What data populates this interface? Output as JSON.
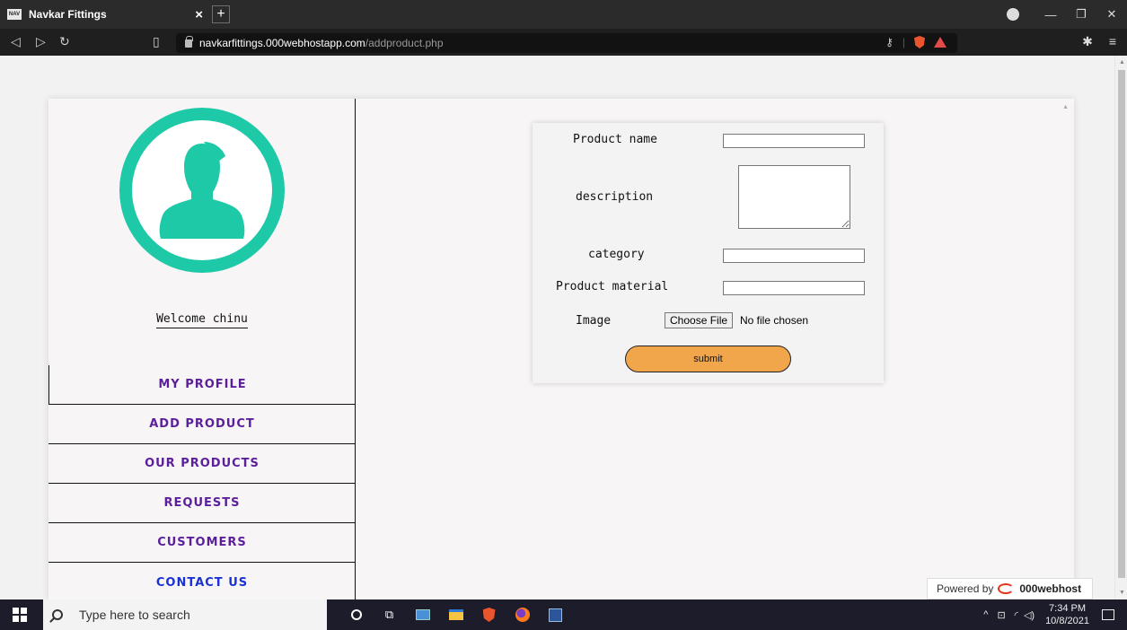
{
  "browser": {
    "tab_title": "Navkar Fittings",
    "favicon_text": "NAV",
    "url_host": "navkarfittings.000webhostapp.com",
    "url_path": "/addproduct.php"
  },
  "sidebar": {
    "welcome_prefix": "Welcome ",
    "username": "chinu",
    "menu": [
      {
        "label": "MY PROFILE"
      },
      {
        "label": "ADD PRODUCT"
      },
      {
        "label": "OUR PRODUCTS"
      },
      {
        "label": "REQUESTS"
      },
      {
        "label": "CUSTOMERS"
      },
      {
        "label": "CONTACT US"
      }
    ]
  },
  "form": {
    "product_name_label": "Product name",
    "description_label": "description",
    "category_label": "category",
    "material_label": "Product material",
    "image_label": "Image",
    "file_button": "Choose File",
    "file_status": "No file chosen",
    "submit_label": "submit",
    "product_name_value": "",
    "description_value": "",
    "category_value": "",
    "material_value": ""
  },
  "powered": {
    "prefix": "Powered by",
    "brand": "000webhost"
  },
  "taskbar": {
    "search_placeholder": "Type here to search",
    "time": "7:34 PM",
    "date": "10/8/2021"
  },
  "colors": {
    "avatar": "#1ec9a8",
    "menu_text": "#5c1f9c",
    "contact_text": "#1a31d6",
    "submit_bg": "#f2a64b"
  }
}
